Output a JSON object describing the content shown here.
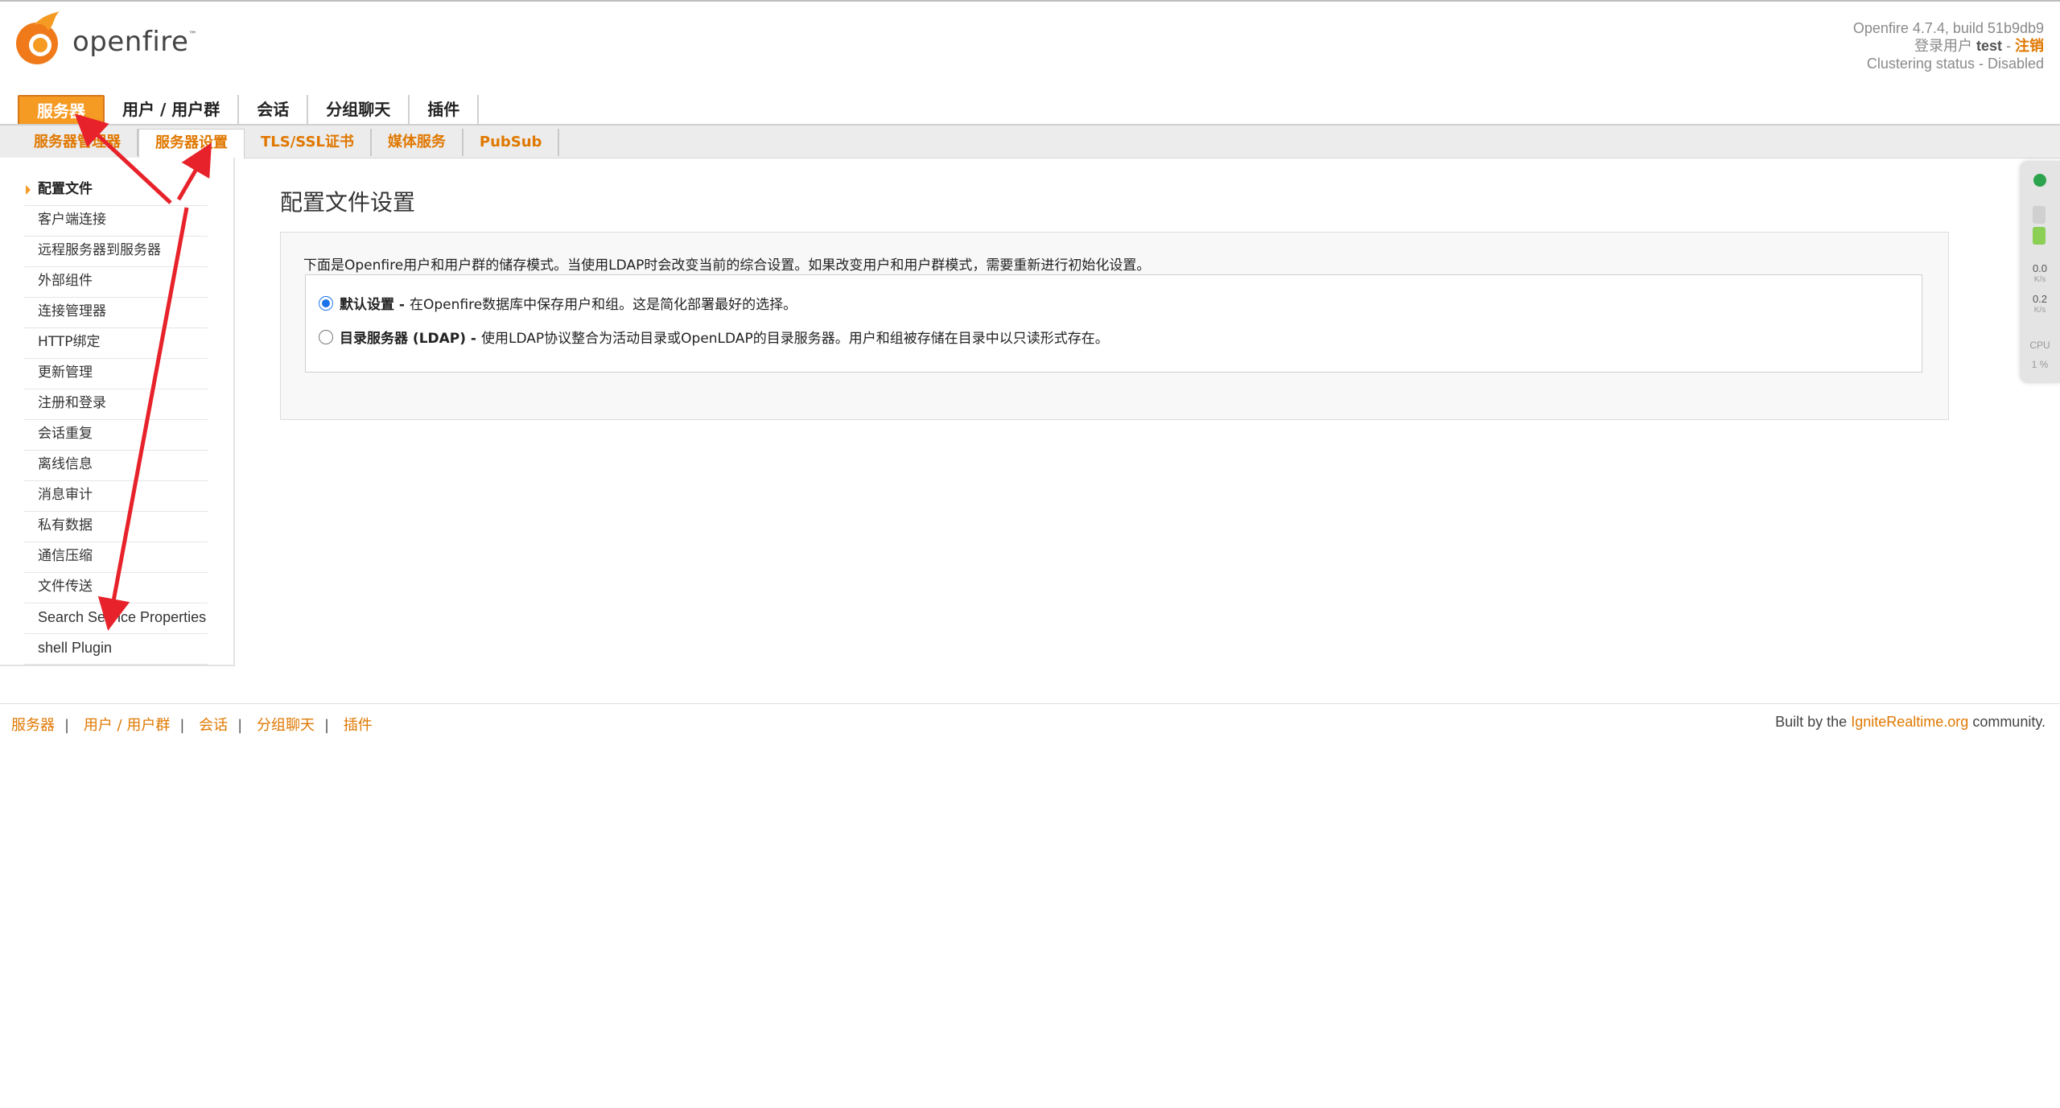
{
  "header": {
    "logo_text": "openfire",
    "version": "Openfire 4.7.4, build 51b9db9",
    "login_prefix": "登录用户",
    "username": "test",
    "logout_label": "注销",
    "clustering": "Clustering status - Disabled"
  },
  "main_tabs": [
    {
      "label": "服务器",
      "active": true
    },
    {
      "label": "用户 / 用户群",
      "active": false
    },
    {
      "label": "会话",
      "active": false
    },
    {
      "label": "分组聊天",
      "active": false
    },
    {
      "label": "插件",
      "active": false
    }
  ],
  "sub_tabs": [
    {
      "label": "服务器管理器",
      "active": false
    },
    {
      "label": "服务器设置",
      "active": true
    },
    {
      "label": "TLS/SSL证书",
      "active": false
    },
    {
      "label": "媒体服务",
      "active": false
    },
    {
      "label": "PubSub",
      "active": false
    }
  ],
  "sidebar": {
    "items": [
      {
        "label": "配置文件",
        "active": true
      },
      {
        "label": "客户端连接"
      },
      {
        "label": "远程服务器到服务器"
      },
      {
        "label": "外部组件"
      },
      {
        "label": "连接管理器"
      },
      {
        "label": "HTTP绑定"
      },
      {
        "label": "更新管理"
      },
      {
        "label": "注册和登录"
      },
      {
        "label": "会话重复"
      },
      {
        "label": "离线信息"
      },
      {
        "label": "消息审计"
      },
      {
        "label": "私有数据"
      },
      {
        "label": "通信压缩"
      },
      {
        "label": "文件传送"
      },
      {
        "label": "Search Service Properties"
      },
      {
        "label": "shell Plugin"
      }
    ]
  },
  "main": {
    "title": "配置文件设置",
    "intro": "下面是Openfire用户和用户群的储存模式。当使用LDAP时会改变当前的综合设置。如果改变用户和用户群模式，需要重新进行初始化设置。",
    "options": [
      {
        "label": "默认设置 -",
        "desc": "在Openfire数据库中保存用户和组。这是简化部署最好的选择。",
        "checked": true
      },
      {
        "label": "目录服务器 (LDAP) -",
        "desc": "使用LDAP协议整合为活动目录或OpenLDAP的目录服务器。用户和组被存储在目录中以只读形式存在。",
        "checked": false
      }
    ]
  },
  "monitor": {
    "up_value": "0.0",
    "up_unit": "K/s",
    "down_value": "0.2",
    "down_unit": "K/s",
    "cpu_label": "CPU",
    "cpu_value": "1 %"
  },
  "footer": {
    "links": [
      "服务器",
      "用户 / 用户群",
      "会话",
      "分组聊天",
      "插件"
    ],
    "credit_prefix": "Built by the",
    "credit_link": "IgniteRealtime.org",
    "credit_suffix": "community."
  }
}
